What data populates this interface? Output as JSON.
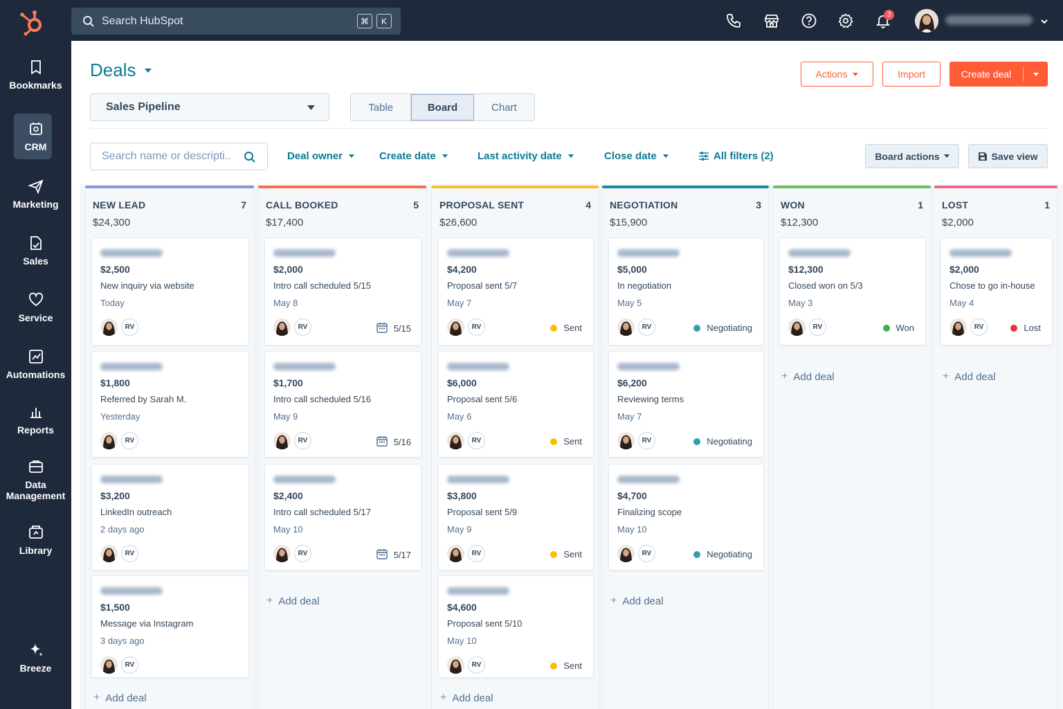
{
  "topbar": {
    "search_placeholder": "Search HubSpot",
    "kbd_cmd": "⌘",
    "kbd_k": "K",
    "notification_count": "3"
  },
  "sidebar": {
    "items": [
      {
        "label": "Bookmarks",
        "icon": "bookmark-icon"
      },
      {
        "label": "CRM",
        "icon": "crm-icon"
      },
      {
        "label": "Marketing",
        "icon": "send-icon"
      },
      {
        "label": "Sales",
        "icon": "sales-icon"
      },
      {
        "label": "Service",
        "icon": "heart-icon"
      },
      {
        "label": "Automations",
        "icon": "automation-icon"
      },
      {
        "label": "Reports",
        "icon": "chart-icon"
      },
      {
        "label": "Data Management",
        "icon": "database-icon"
      },
      {
        "label": "Library",
        "icon": "library-icon"
      },
      {
        "label": "Breeze",
        "icon": "sparkle-icon"
      }
    ]
  },
  "header": {
    "title": "Deals",
    "actions_label": "Actions",
    "import_label": "Import",
    "create_label": "Create deal"
  },
  "pipeline": {
    "selected": "Sales Pipeline"
  },
  "views": [
    "Table",
    "Board",
    "Chart"
  ],
  "active_view": "Board",
  "filters": {
    "search_placeholder": "Search name or descripti..",
    "deal_owner": "Deal owner",
    "create_date": "Create date",
    "last_activity": "Last activity date",
    "close_date": "Close date",
    "all_filters": "All filters (2)",
    "board_actions": "Board actions",
    "save_view": "Save view"
  },
  "add_deal_label": "Add deal",
  "colors": {
    "accent": "#ff5c35",
    "link": "#0b7b96",
    "sent": "#f5c000",
    "negotiating": "#2e9fae",
    "won": "#3bb34a",
    "lost": "#e8323c"
  },
  "columns": [
    {
      "name": "NEW LEAD",
      "count": "7",
      "total": "$24,300",
      "color": "#8b95d6",
      "cards": [
        {
          "amount": "$2,500",
          "desc": "New inquiry via website",
          "date": "Today",
          "owner": "RV"
        },
        {
          "amount": "$1,800",
          "desc": "Referred by Sarah M.",
          "date": "Yesterday",
          "owner": "RV"
        },
        {
          "amount": "$3,200",
          "desc": "LinkedIn outreach",
          "date": "2 days ago",
          "owner": "RV"
        },
        {
          "amount": "$1,500",
          "desc": "Message via Instagram",
          "date": "3 days ago",
          "owner": "RV"
        }
      ]
    },
    {
      "name": "CALL BOOKED",
      "count": "5",
      "total": "$17,400",
      "color": "#f5714f",
      "cards": [
        {
          "amount": "$2,000",
          "desc": "Intro call scheduled 5/15",
          "date": "May 8",
          "owner": "RV",
          "cal": "5/15"
        },
        {
          "amount": "$1,700",
          "desc": "Intro call scheduled 5/16",
          "date": "May 9",
          "owner": "RV",
          "cal": "5/16"
        },
        {
          "amount": "$2,400",
          "desc": "Intro call scheduled 5/17",
          "date": "May 10",
          "owner": "RV",
          "cal": "5/17"
        }
      ]
    },
    {
      "name": "PROPOSAL SENT",
      "count": "4",
      "total": "$26,600",
      "color": "#f5c026",
      "cards": [
        {
          "amount": "$4,200",
          "desc": "Proposal sent 5/7",
          "date": "May 7",
          "owner": "RV",
          "status": "Sent"
        },
        {
          "amount": "$6,000",
          "desc": "Proposal sent 5/6",
          "date": "May 6",
          "owner": "RV",
          "status": "Sent"
        },
        {
          "amount": "$3,800",
          "desc": "Proposal sent 5/9",
          "date": "May 9",
          "owner": "RV",
          "status": "Sent"
        },
        {
          "amount": "$4,600",
          "desc": "Proposal sent 5/10",
          "date": "May 10",
          "owner": "RV",
          "status": "Sent"
        }
      ]
    },
    {
      "name": "NEGOTIATION",
      "count": "3",
      "total": "$15,900",
      "color": "#1b8a9c",
      "cards": [
        {
          "amount": "$5,000",
          "desc": "In negotiation",
          "date": "May 5",
          "owner": "RV",
          "status": "Negotiating"
        },
        {
          "amount": "$6,200",
          "desc": "Reviewing terms",
          "date": "May 7",
          "owner": "RV",
          "status": "Negotiating"
        },
        {
          "amount": "$4,700",
          "desc": "Finalizing scope",
          "date": "May 10",
          "owner": "RV",
          "status": "Negotiating"
        }
      ]
    },
    {
      "name": "WON",
      "count": "1",
      "total": "$12,300",
      "color": "#6cbf61",
      "cards": [
        {
          "amount": "$12,300",
          "desc": "Closed won on 5/3",
          "date": "May 3",
          "owner": "RV",
          "status": "Won"
        }
      ]
    },
    {
      "name": "LOST",
      "count": "1",
      "total": "$2,000",
      "color": "#f06a86",
      "cards": [
        {
          "amount": "$2,000",
          "desc": "Chose to go in-house",
          "date": "May 4",
          "owner": "RV",
          "status": "Lost"
        }
      ]
    }
  ]
}
